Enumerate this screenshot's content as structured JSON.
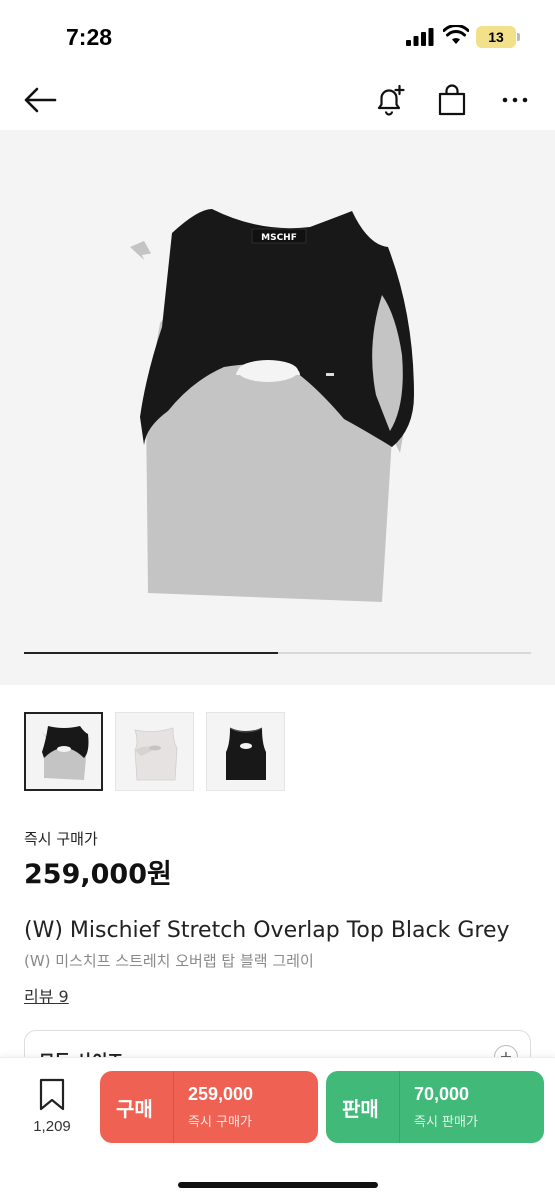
{
  "status_bar": {
    "time": "7:28",
    "battery": "13"
  },
  "product": {
    "image_progress": 0.5,
    "logo_text": "MSCHF",
    "price_label": "즉시 구매가",
    "price": "259,000원",
    "title_en": "(W) Mischief Stretch Overlap Top Black Grey",
    "title_ko": "(W) 미스치프 스트레치 오버랩 탑 블랙 그레이",
    "review_link": "리뷰 9"
  },
  "size_selector": {
    "label": "모든 사이즈",
    "toggle": "+"
  },
  "bottom_bar": {
    "wish_count": "1,209",
    "buy": {
      "label": "구매",
      "price": "259,000",
      "sub": "즉시 구매가"
    },
    "sell": {
      "label": "판매",
      "price": "70,000",
      "sub": "즉시 판매가"
    }
  },
  "icons": [
    "back-arrow-icon",
    "bell-plus-icon",
    "shopping-bag-icon",
    "more-icon",
    "bookmark-icon"
  ],
  "colors": {
    "buy": "#ef6253",
    "sell": "#41b979"
  }
}
